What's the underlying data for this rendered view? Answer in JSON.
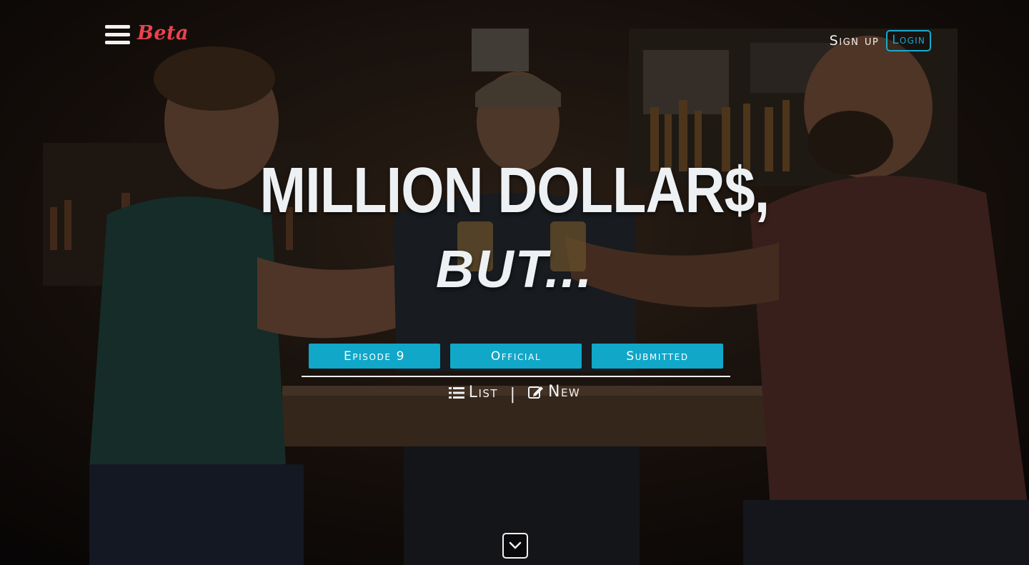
{
  "header": {
    "beta_label": "Beta",
    "signup_label": "Sign up",
    "login_label": "Login"
  },
  "hero": {
    "title": "MILLION DOLLAR$,",
    "subtitle": "BUT..."
  },
  "episode_buttons": [
    {
      "label": "Episode 9"
    },
    {
      "label": "Official"
    },
    {
      "label": "Submitted"
    }
  ],
  "actions": {
    "list_label": "List",
    "separator": "|",
    "new_label": "New"
  },
  "icons": {
    "menu": "hamburger-menu-icon",
    "list": "list-icon",
    "new": "edit-icon",
    "scroll": "chevron-down-icon"
  },
  "colors": {
    "accent": "#10a7c9",
    "beta": "#e8434f",
    "text": "#eef1f3"
  }
}
